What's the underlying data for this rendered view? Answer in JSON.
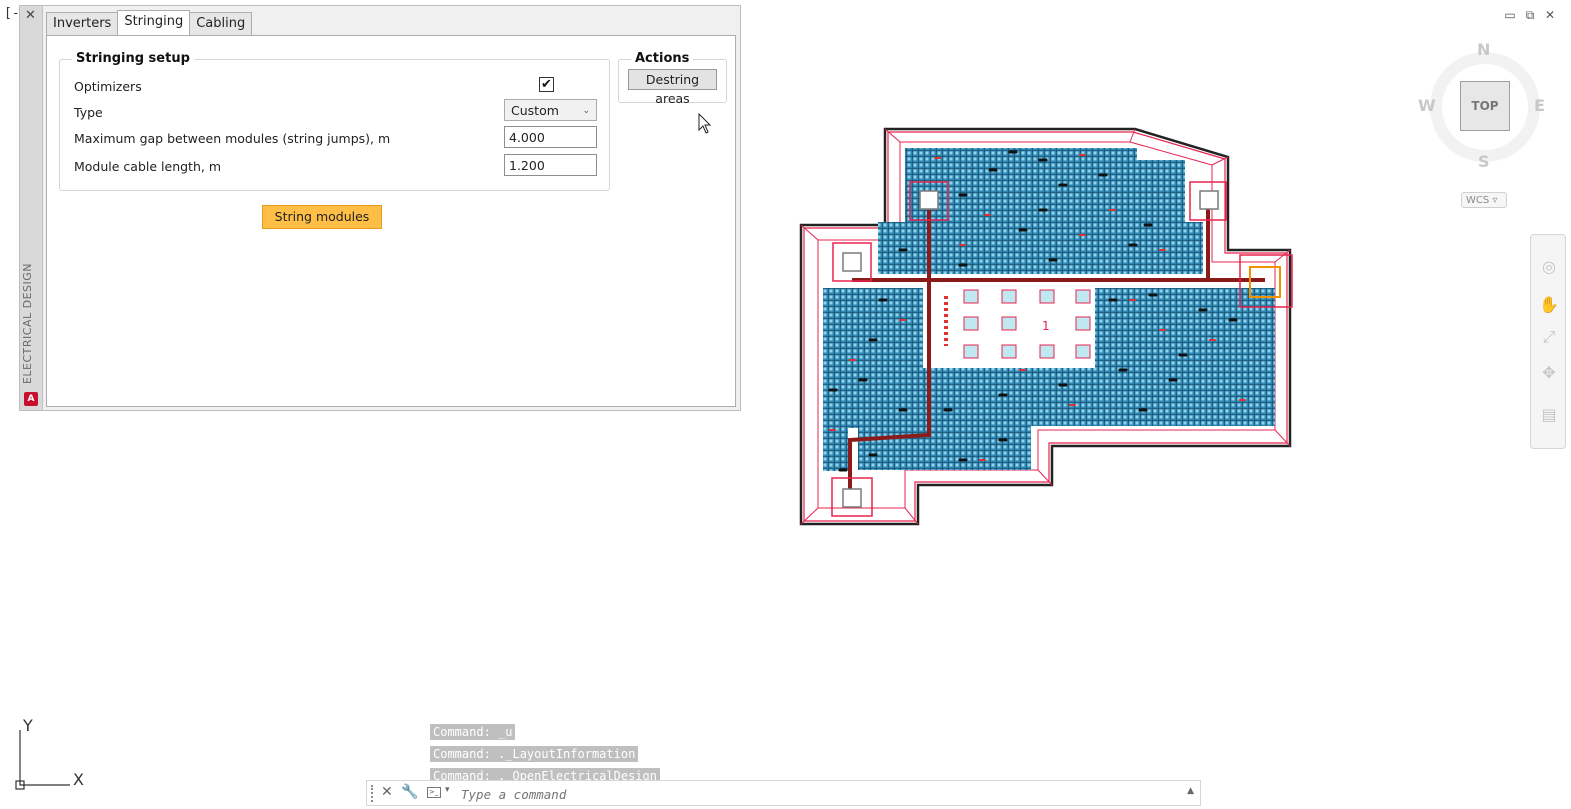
{
  "viewport": {
    "label": "[-]"
  },
  "window_controls": {
    "minimize": "▭",
    "restore": "⧉",
    "close": "✕"
  },
  "palette": {
    "close_label": "✕",
    "vertical_title": "ELECTRICAL DESIGN",
    "logo": "A",
    "tabs": [
      {
        "label": "Inverters"
      },
      {
        "label": "Stringing"
      },
      {
        "label": "Cabling"
      }
    ],
    "stringing_setup": {
      "title": "Stringing setup",
      "optimizers_label": "Optimizers",
      "optimizers_checked": true,
      "check_mark": "✔",
      "type_label": "Type",
      "type_value": "Custom",
      "max_gap_label": "Maximum gap between modules (string jumps), m",
      "max_gap_value": "4.000",
      "cable_length_label": "Module cable length, m",
      "cable_length_value": "1.200"
    },
    "actions": {
      "title": "Actions",
      "destring_label": "Destring areas"
    },
    "string_modules_label": "String modules"
  },
  "drawing": {
    "block_label": "1"
  },
  "viewcube": {
    "top": "TOP",
    "north": "N",
    "south": "S",
    "east": "E",
    "west": "W",
    "wcs": "WCS ▿"
  },
  "ucs": {
    "x": "X",
    "y": "Y"
  },
  "command": {
    "history": [
      "Command: _u",
      "Command: ._LayoutInformation",
      "Command: ._OpenElectricalDesign"
    ],
    "placeholder": "Type a command"
  }
}
